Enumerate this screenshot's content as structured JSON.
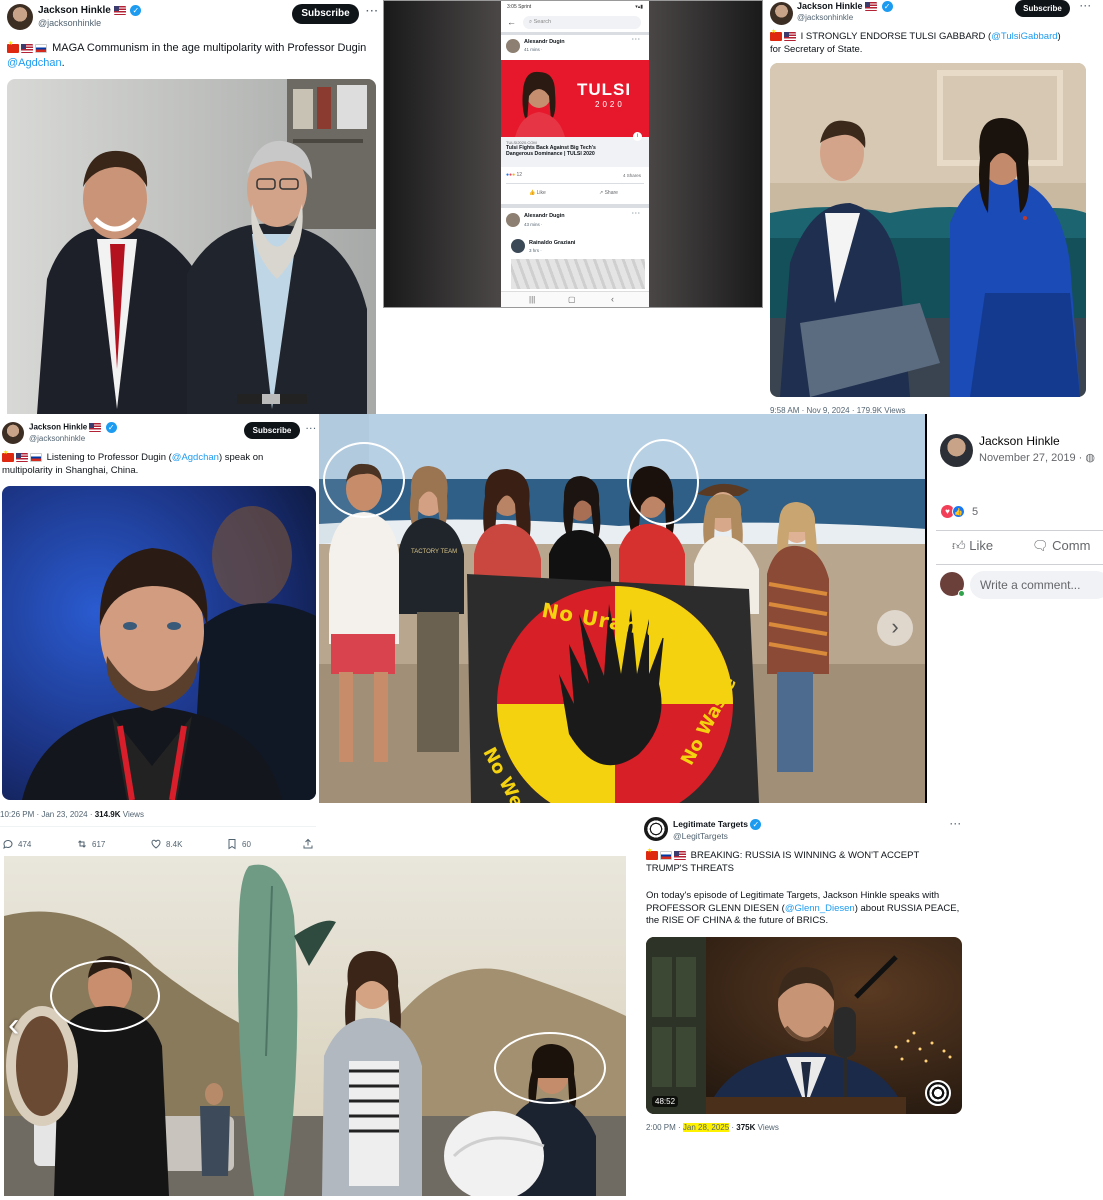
{
  "tweet1": {
    "name": "Jackson Hinkle",
    "handle": "@jacksonhinkle",
    "subscribe": "Subscribe",
    "more": "···",
    "text": "MAGA Communism in the age multipolarity with Professor Dugin ",
    "mention": "@Agdchan",
    "text_end": "."
  },
  "phone": {
    "status_time": "3:05 Sprint",
    "search_placeholder": "Search",
    "post1_author": "Alexandr Dugin",
    "post1_time": "41 mins · ",
    "ad_title": "TULSI",
    "ad_year": "2020",
    "link_domain": "TULSI2020.COM",
    "link_title": "Tulsi Fights Back Against Big Tech's Dangerous Dominance | TULSI 2020",
    "reactions_count": "12",
    "shares": "4 Shares",
    "like": "Like",
    "share": "Share",
    "post2_author": "Alexandr Dugin",
    "post2_time": "43 mins · ",
    "commenter": "Rainaldo Graziani",
    "comment_time": "3 hrs · "
  },
  "tweet2": {
    "name": "Jackson Hinkle",
    "handle": "@jacksonhinkle",
    "subscribe": "Subscribe",
    "more": "···",
    "text": "I STRONGLY ENDORSE TULSI GABBARD (",
    "mention": "@TulsiGabbard",
    "text_end": ") for Secretary of State.",
    "meta": "9:58 AM · Nov 9, 2024 · 179.9K Views"
  },
  "tweet3": {
    "name": "Jackson Hinkle",
    "handle": "@jacksonhinkle",
    "subscribe": "Subscribe",
    "more": "···",
    "text": "Listening to Professor Dugin (",
    "mention": "@Agdchan",
    "text_end": ") speak on multipolarity in Shanghai, China.",
    "time": "10:26 PM · Jan 23, 2024 · ",
    "views": "314.9K",
    "views_label": " Views",
    "replies": "474",
    "reposts": "617",
    "likes": "8.4K",
    "bookmarks": "60"
  },
  "beach_photo": {
    "banner_line1": "No Uranium",
    "banner_line2": "No Weapons",
    "banner_line3": "No Waste",
    "shirt_text": "TACTORY TEAM"
  },
  "fb_post": {
    "name": "Jackson Hinkle",
    "date": "November 27, 2019 · ",
    "reaction_count": "5",
    "like": "Like",
    "comment": "Comm",
    "comment_placeholder": "Write a comment..."
  },
  "tweet4": {
    "name": "Legitimate Targets",
    "handle": "@LegitTargets",
    "more": "···",
    "headline": "BREAKING: RUSSIA IS WINNING & WON'T ACCEPT TRUMP'S THREATS",
    "body_start": "On today's episode of Legitimate Targets, Jackson Hinkle speaks with PROFESSOR GLENN DIESEN (",
    "mention": "@Glenn_Diesen",
    "body_end": ") about RUSSIA PEACE, the RISE OF CHINA & the future of BRICS.",
    "duration": "48:52",
    "time": "2:00 PM · ",
    "date": "Jan 28, 2025",
    "sep": " · ",
    "views": "375K",
    "views_label": " Views"
  },
  "colors": {
    "x_blue": "#1d9bf0",
    "fb_blue": "#1877f2",
    "highlight": "#fff200",
    "tulsi_red": "#e8182c"
  }
}
